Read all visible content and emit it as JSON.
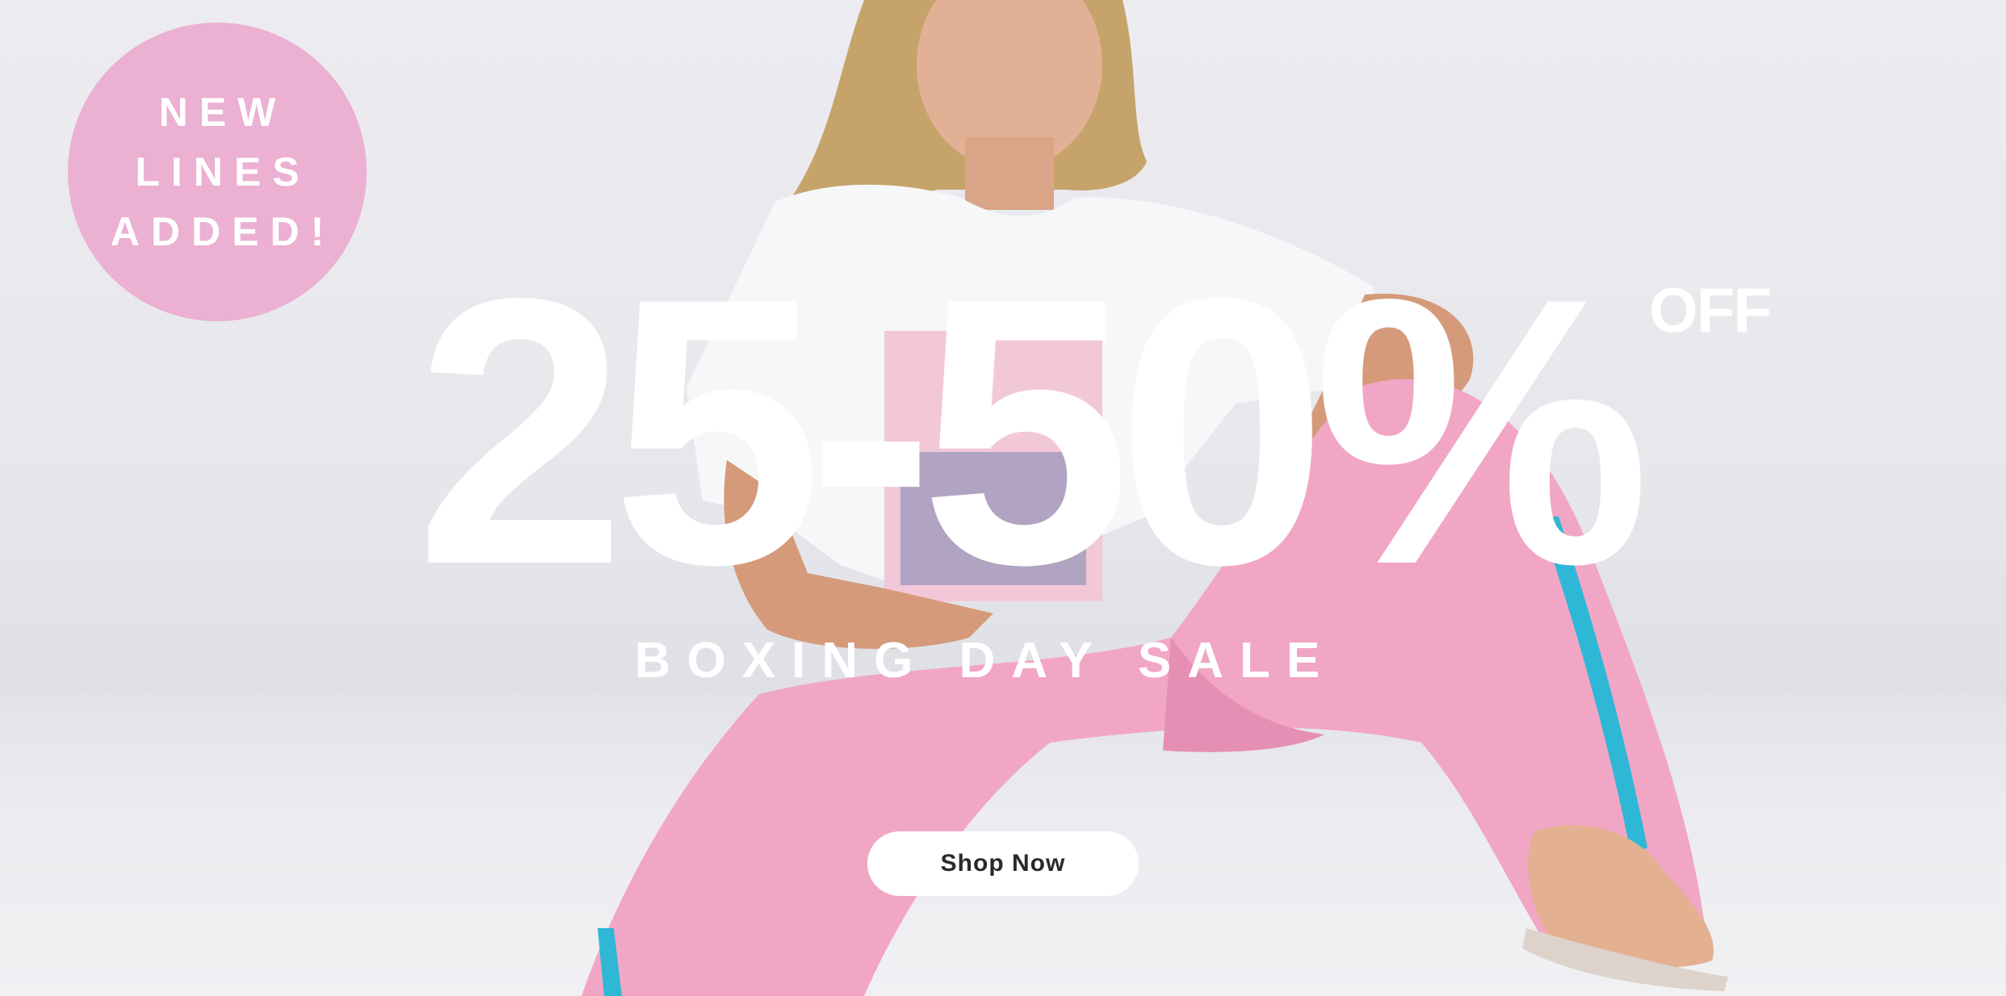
{
  "banner": {
    "badge": {
      "lines": [
        "NEW",
        "LINES",
        "ADDED!"
      ],
      "color": "#ebb0d2"
    },
    "headline": "25-50%",
    "headline_suffix": "OFF",
    "subheadline": "BOXING DAY SALE",
    "cta_label": "Shop Now"
  },
  "colors": {
    "badge_pink": "#ebb0d2",
    "pants_pink": "#f2a6c6",
    "stripe_cyan": "#2fb7d6",
    "text": "#ffffff",
    "button_text": "#2a2a2a"
  }
}
